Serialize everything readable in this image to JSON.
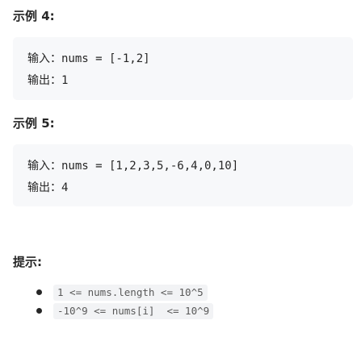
{
  "example4": {
    "title": "示例 4:",
    "input_label": "输入：",
    "input_value": "nums = [-1,2]",
    "output_label": "输出：",
    "output_value": "1"
  },
  "example5": {
    "title": "示例 5:",
    "input_label": "输入：",
    "input_value": "nums = [1,2,3,5,-6,4,0,10]",
    "output_label": "输出：",
    "output_value": "4"
  },
  "hints": {
    "title": "提示:",
    "items": [
      "1 <= nums.length <= 10^5",
      "-10^9 <= nums[i]  <= 10^9"
    ]
  }
}
